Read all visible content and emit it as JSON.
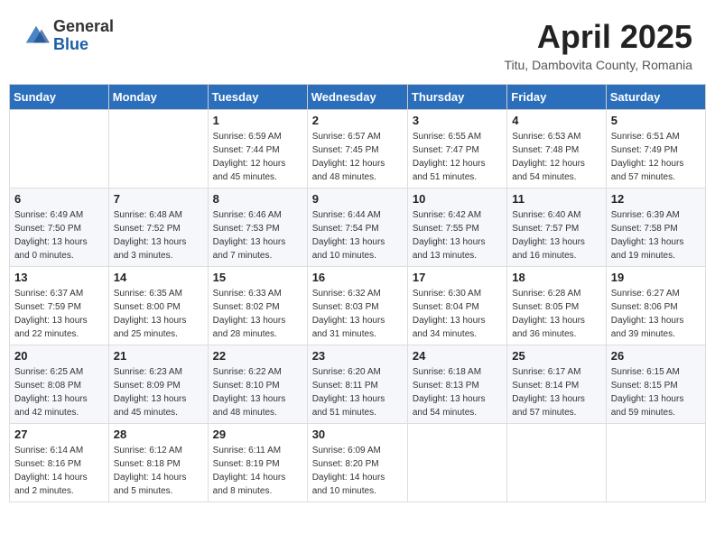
{
  "logo": {
    "general": "General",
    "blue": "Blue"
  },
  "header": {
    "month": "April 2025",
    "location": "Titu, Dambovita County, Romania"
  },
  "weekdays": [
    "Sunday",
    "Monday",
    "Tuesday",
    "Wednesday",
    "Thursday",
    "Friday",
    "Saturday"
  ],
  "weeks": [
    [
      {
        "day": "",
        "info": ""
      },
      {
        "day": "",
        "info": ""
      },
      {
        "day": "1",
        "info": "Sunrise: 6:59 AM\nSunset: 7:44 PM\nDaylight: 12 hours\nand 45 minutes."
      },
      {
        "day": "2",
        "info": "Sunrise: 6:57 AM\nSunset: 7:45 PM\nDaylight: 12 hours\nand 48 minutes."
      },
      {
        "day": "3",
        "info": "Sunrise: 6:55 AM\nSunset: 7:47 PM\nDaylight: 12 hours\nand 51 minutes."
      },
      {
        "day": "4",
        "info": "Sunrise: 6:53 AM\nSunset: 7:48 PM\nDaylight: 12 hours\nand 54 minutes."
      },
      {
        "day": "5",
        "info": "Sunrise: 6:51 AM\nSunset: 7:49 PM\nDaylight: 12 hours\nand 57 minutes."
      }
    ],
    [
      {
        "day": "6",
        "info": "Sunrise: 6:49 AM\nSunset: 7:50 PM\nDaylight: 13 hours\nand 0 minutes."
      },
      {
        "day": "7",
        "info": "Sunrise: 6:48 AM\nSunset: 7:52 PM\nDaylight: 13 hours\nand 3 minutes."
      },
      {
        "day": "8",
        "info": "Sunrise: 6:46 AM\nSunset: 7:53 PM\nDaylight: 13 hours\nand 7 minutes."
      },
      {
        "day": "9",
        "info": "Sunrise: 6:44 AM\nSunset: 7:54 PM\nDaylight: 13 hours\nand 10 minutes."
      },
      {
        "day": "10",
        "info": "Sunrise: 6:42 AM\nSunset: 7:55 PM\nDaylight: 13 hours\nand 13 minutes."
      },
      {
        "day": "11",
        "info": "Sunrise: 6:40 AM\nSunset: 7:57 PM\nDaylight: 13 hours\nand 16 minutes."
      },
      {
        "day": "12",
        "info": "Sunrise: 6:39 AM\nSunset: 7:58 PM\nDaylight: 13 hours\nand 19 minutes."
      }
    ],
    [
      {
        "day": "13",
        "info": "Sunrise: 6:37 AM\nSunset: 7:59 PM\nDaylight: 13 hours\nand 22 minutes."
      },
      {
        "day": "14",
        "info": "Sunrise: 6:35 AM\nSunset: 8:00 PM\nDaylight: 13 hours\nand 25 minutes."
      },
      {
        "day": "15",
        "info": "Sunrise: 6:33 AM\nSunset: 8:02 PM\nDaylight: 13 hours\nand 28 minutes."
      },
      {
        "day": "16",
        "info": "Sunrise: 6:32 AM\nSunset: 8:03 PM\nDaylight: 13 hours\nand 31 minutes."
      },
      {
        "day": "17",
        "info": "Sunrise: 6:30 AM\nSunset: 8:04 PM\nDaylight: 13 hours\nand 34 minutes."
      },
      {
        "day": "18",
        "info": "Sunrise: 6:28 AM\nSunset: 8:05 PM\nDaylight: 13 hours\nand 36 minutes."
      },
      {
        "day": "19",
        "info": "Sunrise: 6:27 AM\nSunset: 8:06 PM\nDaylight: 13 hours\nand 39 minutes."
      }
    ],
    [
      {
        "day": "20",
        "info": "Sunrise: 6:25 AM\nSunset: 8:08 PM\nDaylight: 13 hours\nand 42 minutes."
      },
      {
        "day": "21",
        "info": "Sunrise: 6:23 AM\nSunset: 8:09 PM\nDaylight: 13 hours\nand 45 minutes."
      },
      {
        "day": "22",
        "info": "Sunrise: 6:22 AM\nSunset: 8:10 PM\nDaylight: 13 hours\nand 48 minutes."
      },
      {
        "day": "23",
        "info": "Sunrise: 6:20 AM\nSunset: 8:11 PM\nDaylight: 13 hours\nand 51 minutes."
      },
      {
        "day": "24",
        "info": "Sunrise: 6:18 AM\nSunset: 8:13 PM\nDaylight: 13 hours\nand 54 minutes."
      },
      {
        "day": "25",
        "info": "Sunrise: 6:17 AM\nSunset: 8:14 PM\nDaylight: 13 hours\nand 57 minutes."
      },
      {
        "day": "26",
        "info": "Sunrise: 6:15 AM\nSunset: 8:15 PM\nDaylight: 13 hours\nand 59 minutes."
      }
    ],
    [
      {
        "day": "27",
        "info": "Sunrise: 6:14 AM\nSunset: 8:16 PM\nDaylight: 14 hours\nand 2 minutes."
      },
      {
        "day": "28",
        "info": "Sunrise: 6:12 AM\nSunset: 8:18 PM\nDaylight: 14 hours\nand 5 minutes."
      },
      {
        "day": "29",
        "info": "Sunrise: 6:11 AM\nSunset: 8:19 PM\nDaylight: 14 hours\nand 8 minutes."
      },
      {
        "day": "30",
        "info": "Sunrise: 6:09 AM\nSunset: 8:20 PM\nDaylight: 14 hours\nand 10 minutes."
      },
      {
        "day": "",
        "info": ""
      },
      {
        "day": "",
        "info": ""
      },
      {
        "day": "",
        "info": ""
      }
    ]
  ]
}
